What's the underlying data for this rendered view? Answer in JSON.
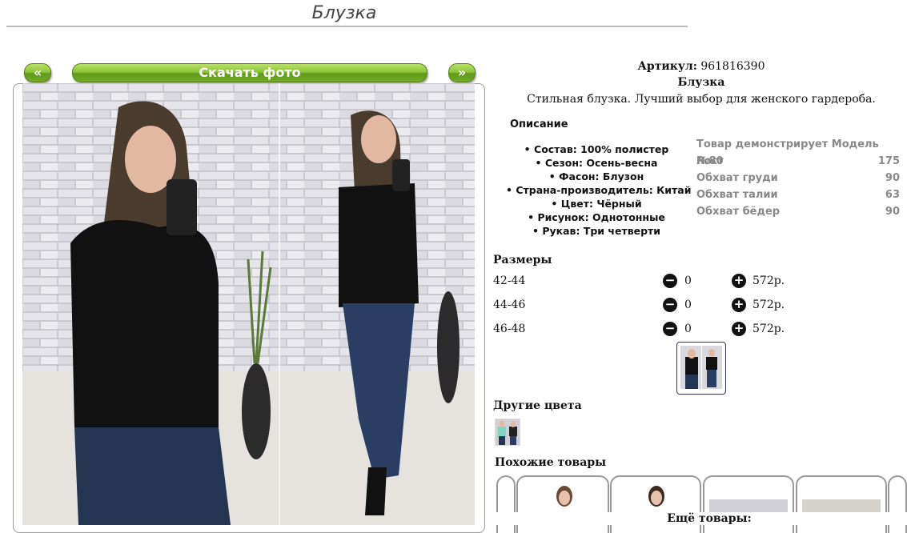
{
  "page": {
    "title": "Блузка"
  },
  "gallery": {
    "prev_label": "«",
    "next_label": "»",
    "download_label": "Скачать фото"
  },
  "product": {
    "article_label": "Артикул:",
    "article_value": "961816390",
    "name": "Блузка",
    "tagline": "Стильная блузка. Лучший выбор для женского гардероба.",
    "description_heading": "Описание",
    "features": [
      "Состав: 100% полистер",
      "Сезон: Осень-весна",
      "Фасон: Блузон",
      "Страна-производитель: Китай",
      "Цвет: Чёрный",
      "Рисунок: Однотонные",
      "Рукав: Три четверти"
    ]
  },
  "model": {
    "heading": "Товар демонстрирует Модель №80",
    "rows": [
      {
        "label": "Рост",
        "value": "175"
      },
      {
        "label": "Обхват груди",
        "value": "90"
      },
      {
        "label": "Обхват талии",
        "value": "63"
      },
      {
        "label": "Обхват бёдер",
        "value": "90"
      }
    ]
  },
  "sizes": {
    "heading": "Размеры",
    "rows": [
      {
        "size": "42-44",
        "qty": "0",
        "price": "572р."
      },
      {
        "size": "44-46",
        "qty": "0",
        "price": "572р."
      },
      {
        "size": "46-48",
        "qty": "0",
        "price": "572р."
      }
    ]
  },
  "other_colors": {
    "heading": "Другие цвета"
  },
  "similar": {
    "heading": "Похожие товары",
    "more_label": "Ещё товары:"
  },
  "icons": {
    "minus": "minus-circle-icon",
    "plus": "plus-circle-icon",
    "bullet": "bullet-icon"
  },
  "colors": {
    "button_green": "#8cc63a",
    "product_color": "#111111"
  }
}
